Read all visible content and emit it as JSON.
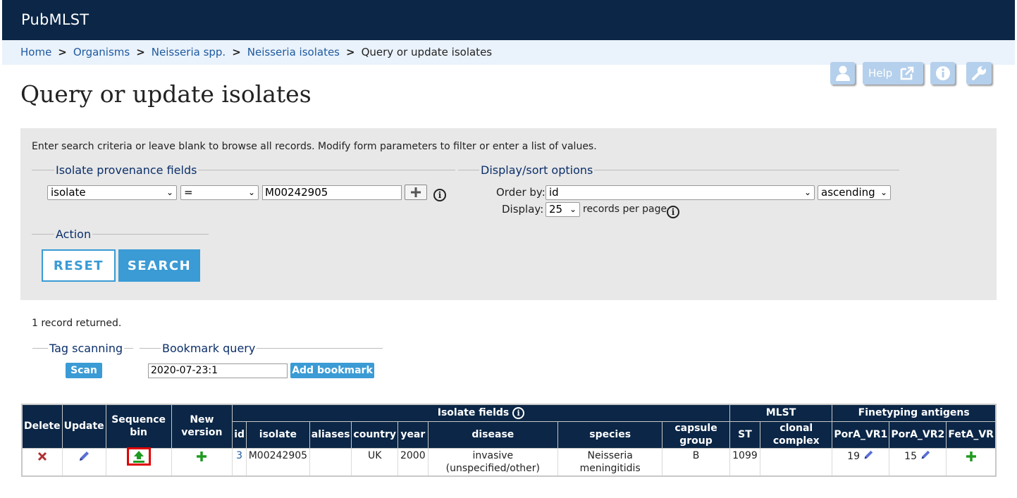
{
  "header": {
    "site_name": "PubMLST"
  },
  "breadcrumb": {
    "links": [
      "Home",
      "Organisms",
      "Neisseria spp.",
      "Neisseria isolates"
    ],
    "current": "Query or update isolates",
    "separator": ">"
  },
  "toolbar": {
    "help_label": "Help"
  },
  "page": {
    "title": "Query or update isolates"
  },
  "form": {
    "intro": "Enter search criteria or leave blank to browse all records. Modify form parameters to filter or enter a list of values.",
    "provenance_legend": "Isolate provenance fields",
    "field_select": "isolate",
    "operator_select": "=",
    "value_input": "M00242905",
    "display_legend": "Display/sort options",
    "order_by_label": "Order by:",
    "order_by_value": "id",
    "order_dir": "ascending",
    "display_label": "Display:",
    "display_value": "25",
    "records_per_page": "records per page",
    "action_legend": "Action",
    "reset_label": "RESET",
    "search_label": "SEARCH"
  },
  "results": {
    "count_text": "1 record returned.",
    "tag_scanning_legend": "Tag scanning",
    "scan_label": "Scan",
    "bookmark_legend": "Bookmark query",
    "bookmark_value": "2020-07-23:1",
    "add_bookmark_label": "Add bookmark"
  },
  "table": {
    "group_headers": {
      "isolate_fields": "Isolate fields",
      "mlst": "MLST",
      "finetyping": "Finetyping antigens"
    },
    "col_delete": "Delete",
    "col_update": "Update",
    "col_seqbin_1": "Sequence",
    "col_seqbin_2": "bin",
    "col_newversion_1": "New",
    "col_newversion_2": "version",
    "cols": {
      "id": "id",
      "isolate": "isolate",
      "aliases": "aliases",
      "country": "country",
      "year": "year",
      "disease": "disease",
      "species": "species",
      "capsule_1": "capsule",
      "capsule_2": "group",
      "st": "ST",
      "clonal_1": "clonal",
      "clonal_2": "complex",
      "porA_vr1": "PorA_VR1",
      "porA_vr2": "PorA_VR2",
      "fetA_vr": "FetA_VR"
    },
    "row": {
      "id": "3",
      "isolate": "M00242905",
      "aliases": "",
      "country": "UK",
      "year": "2000",
      "disease_1": "invasive",
      "disease_2": "(unspecified/other)",
      "species_1": "Neisseria",
      "species_2": "meningitidis",
      "capsule": "B",
      "st": "1099",
      "clonal_complex": "",
      "porA_vr1": "19",
      "porA_vr2": "15"
    }
  },
  "colors": {
    "navbar": "#0b2646",
    "accent": "#3a9bd5",
    "highlight": "#e00000",
    "link": "#1e5aa0"
  }
}
